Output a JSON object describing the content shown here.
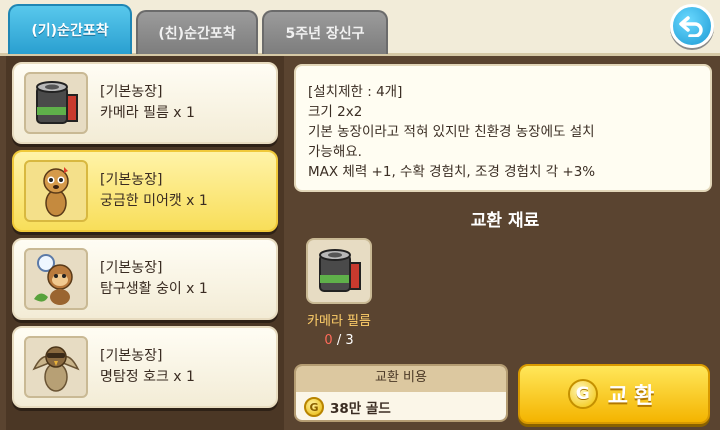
{
  "tabs": [
    {
      "label": "(기)순간포착",
      "active": true
    },
    {
      "label": "(친)순간포착",
      "active": false
    },
    {
      "label": "5주년 장신구",
      "active": false
    }
  ],
  "items": [
    {
      "category": "[기본농장]",
      "name": "카메라 필름 x 1",
      "icon": "camera-film-icon",
      "selected": false
    },
    {
      "category": "[기본농장]",
      "name": "궁금한 미어캣 x 1",
      "icon": "meerkat-icon",
      "selected": true
    },
    {
      "category": "[기본농장]",
      "name": "탐구생활 숭이 x 1",
      "icon": "monkey-icon",
      "selected": false
    },
    {
      "category": "[기본농장]",
      "name": "명탐정 호크 x 1",
      "icon": "hawk-icon",
      "selected": false
    }
  ],
  "description": {
    "lines": [
      "[설치제한 : 4개]",
      "크기 2x2",
      "기본 농장이라고 적혀 있지만 친환경 농장에도 설치",
      "가능해요.",
      "MAX 체력 +1, 수확 경험치, 조경 경험치 각 +3%"
    ]
  },
  "materials": {
    "title": "교환 재료",
    "items": [
      {
        "name": "카메라 필름",
        "have": "0",
        "need": "/ 3",
        "icon": "camera-film-icon"
      }
    ]
  },
  "cost": {
    "header": "교환 비용",
    "coin_symbol": "G",
    "amount": "38만 골드"
  },
  "exchange_button": {
    "coin_symbol": "G",
    "label": "교환"
  },
  "colors": {
    "active_tab": "#2a9fd0",
    "selected_item": "#f8de5a",
    "exchange_button": "#f4b400",
    "material_name": "#ffcf6a",
    "material_have": "#ff6b5a"
  }
}
